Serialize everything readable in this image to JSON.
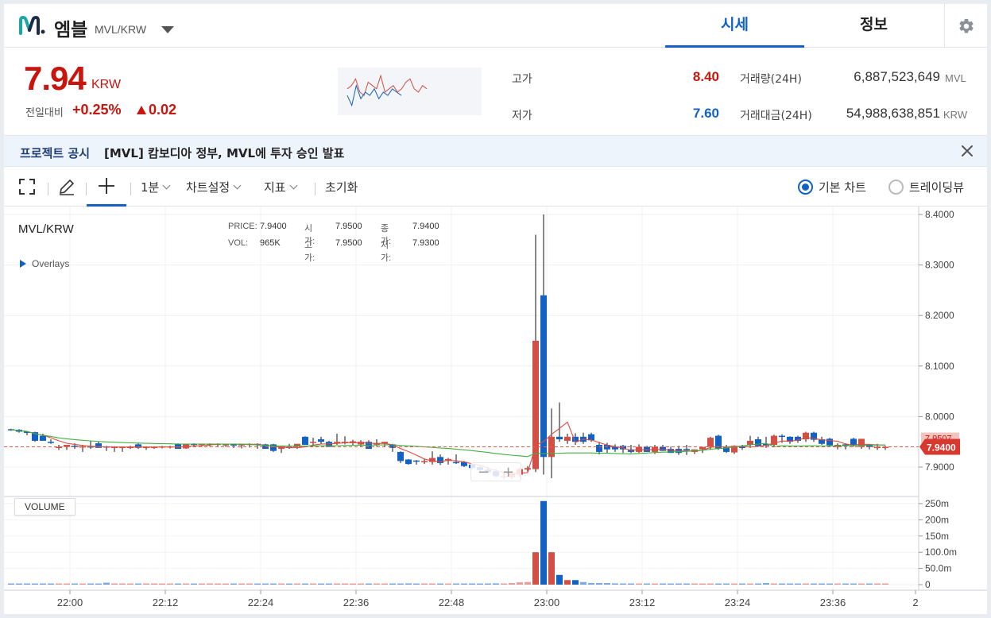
{
  "header": {
    "coin_name": "엠블",
    "pair": "MVL/KRW",
    "tabs": [
      {
        "label": "시세",
        "active": true
      },
      {
        "label": "정보",
        "active": false
      }
    ]
  },
  "summary": {
    "price": "7.94",
    "currency": "KRW",
    "change_label": "전일대비",
    "change_rate": "+0.25%",
    "change_amount": "0.02",
    "high_label": "고가",
    "high_value": "8.40",
    "low_label": "저가",
    "low_value": "7.60",
    "volume_label": "거래량(24H)",
    "volume_value": "6,887,523,649",
    "volume_unit": "MVL",
    "amount_label": "거래대금(24H)",
    "amount_value": "54,988,638,851",
    "amount_unit": "KRW"
  },
  "notice": {
    "tag": "프로젝트 공시",
    "text": "[MVL] 캄보디아 정부, MVL에 투자 승인 발표"
  },
  "toolbar": {
    "interval": "1분",
    "chart_settings": "차트설정",
    "indicators": "지표",
    "reset": "초기화",
    "basic_chart": "기본 차트",
    "tradingview": "트레이딩뷰"
  },
  "chart": {
    "symbol": "MVL/KRW",
    "overlays": "Overlays",
    "ohlc": {
      "price_label": "PRICE:",
      "price": "7.9400",
      "open_label": "시가:",
      "open": "7.9500",
      "close_label": "종가:",
      "close": "7.9400",
      "vol_label": "VOL:",
      "vol": "965K",
      "high_label": "고가:",
      "high": "7.9500",
      "low_label": "저가:",
      "low": "7.9300"
    },
    "volume_label": "VOLUME",
    "current_price_tag": "7.9400",
    "partial_tag": "7.9507",
    "zoom_minus": "−",
    "zoom_plus": "+"
  },
  "colors": {
    "up": "#d24f45",
    "down": "#1261c4",
    "ma_short": "#e04a3f",
    "ma_long": "#3fb13f",
    "accent": "#1261c4"
  },
  "chart_data": {
    "type": "candlestick",
    "symbol": "MVL/KRW",
    "price_axis": {
      "ticks": [
        "8.4000",
        "8.3000",
        "8.2000",
        "8.1000",
        "8.0000",
        "7.9000"
      ],
      "range": [
        7.86,
        8.4
      ]
    },
    "volume_axis": {
      "ticks": [
        "250m",
        "200m",
        "150m",
        "100.0m",
        "50.0m",
        "0"
      ],
      "range": [
        0,
        260
      ]
    },
    "time_ticks": [
      "22:00",
      "22:12",
      "22:24",
      "22:36",
      "22:48",
      "23:00",
      "23:12",
      "23:24",
      "23:36",
      "2"
    ],
    "start_minute": 1314,
    "candles": [
      {
        "o": 7.975,
        "h": 7.976,
        "l": 7.972,
        "c": 7.974,
        "v": 2
      },
      {
        "o": 7.974,
        "h": 7.975,
        "l": 7.968,
        "c": 7.97,
        "v": 2
      },
      {
        "o": 7.97,
        "h": 7.971,
        "l": 7.963,
        "c": 7.968,
        "v": 2
      },
      {
        "o": 7.969,
        "h": 7.97,
        "l": 7.95,
        "c": 7.952,
        "v": 2
      },
      {
        "o": 7.962,
        "h": 7.966,
        "l": 7.958,
        "c": 7.952,
        "v": 3
      },
      {
        "o": 7.95,
        "h": 7.955,
        "l": 7.946,
        "c": 7.948,
        "v": 2
      },
      {
        "o": 7.94,
        "h": 7.944,
        "l": 7.934,
        "c": 7.94,
        "v": 2
      },
      {
        "o": 7.94,
        "h": 7.942,
        "l": 7.934,
        "c": 7.944,
        "v": 3
      },
      {
        "o": 7.942,
        "h": 7.947,
        "l": 7.936,
        "c": 7.941,
        "v": 2
      },
      {
        "o": 7.941,
        "h": 7.944,
        "l": 7.93,
        "c": 7.941,
        "v": 2
      },
      {
        "o": 7.941,
        "h": 7.952,
        "l": 7.936,
        "c": 7.94,
        "v": 2
      },
      {
        "o": 7.947,
        "h": 7.951,
        "l": 7.943,
        "c": 7.938,
        "v": 3
      },
      {
        "o": 7.941,
        "h": 7.942,
        "l": 7.932,
        "c": 7.94,
        "v": 6
      },
      {
        "o": 7.94,
        "h": 7.941,
        "l": 7.93,
        "c": 7.94,
        "v": 2
      },
      {
        "o": 7.94,
        "h": 7.941,
        "l": 7.93,
        "c": 7.94,
        "v": 2
      },
      {
        "o": 7.94,
        "h": 7.942,
        "l": 7.936,
        "c": 7.94,
        "v": 2
      },
      {
        "o": 7.945,
        "h": 7.948,
        "l": 7.936,
        "c": 7.938,
        "v": 2
      },
      {
        "o": 7.94,
        "h": 7.941,
        "l": 7.934,
        "c": 7.94,
        "v": 2
      },
      {
        "o": 7.94,
        "h": 7.941,
        "l": 7.936,
        "c": 7.94,
        "v": 2
      },
      {
        "o": 7.94,
        "h": 7.942,
        "l": 7.937,
        "c": 7.941,
        "v": 2
      },
      {
        "o": 7.941,
        "h": 7.942,
        "l": 7.937,
        "c": 7.941,
        "v": 2
      },
      {
        "o": 7.946,
        "h": 7.947,
        "l": 7.937,
        "c": 7.936,
        "v": 2
      },
      {
        "o": 7.937,
        "h": 7.94,
        "l": 7.936,
        "c": 7.945,
        "v": 2
      },
      {
        "o": 7.946,
        "h": 7.947,
        "l": 7.94,
        "c": 7.945,
        "v": 2
      },
      {
        "o": 7.945,
        "h": 7.946,
        "l": 7.941,
        "c": 7.946,
        "v": 2
      },
      {
        "o": 7.946,
        "h": 7.947,
        "l": 7.941,
        "c": 7.946,
        "v": 2
      },
      {
        "o": 7.946,
        "h": 7.947,
        "l": 7.941,
        "c": 7.946,
        "v": 2
      },
      {
        "o": 7.945,
        "h": 7.946,
        "l": 7.94,
        "c": 7.945,
        "v": 2
      },
      {
        "o": 7.945,
        "h": 7.946,
        "l": 7.938,
        "c": 7.944,
        "v": 2
      },
      {
        "o": 7.944,
        "h": 7.946,
        "l": 7.937,
        "c": 7.945,
        "v": 2
      },
      {
        "o": 7.945,
        "h": 7.947,
        "l": 7.939,
        "c": 7.946,
        "v": 2
      },
      {
        "o": 7.946,
        "h": 7.947,
        "l": 7.936,
        "c": 7.945,
        "v": 2
      },
      {
        "o": 7.945,
        "h": 7.946,
        "l": 7.94,
        "c": 7.936,
        "v": 2
      },
      {
        "o": 7.945,
        "h": 7.946,
        "l": 7.93,
        "c": 7.932,
        "v": 2
      },
      {
        "o": 7.936,
        "h": 7.94,
        "l": 7.928,
        "c": 7.94,
        "v": 2
      },
      {
        "o": 7.94,
        "h": 7.946,
        "l": 7.936,
        "c": 7.938,
        "v": 2
      },
      {
        "o": 7.941,
        "h": 7.944,
        "l": 7.936,
        "c": 7.946,
        "v": 2
      },
      {
        "o": 7.96,
        "h": 7.961,
        "l": 7.945,
        "c": 7.944,
        "v": 2
      },
      {
        "o": 7.95,
        "h": 7.958,
        "l": 7.941,
        "c": 7.95,
        "v": 2
      },
      {
        "o": 7.955,
        "h": 7.96,
        "l": 7.945,
        "c": 7.95,
        "v": 3
      },
      {
        "o": 7.95,
        "h": 7.952,
        "l": 7.944,
        "c": 7.94,
        "v": 2
      },
      {
        "o": 7.95,
        "h": 7.966,
        "l": 7.944,
        "c": 7.95,
        "v": 2
      },
      {
        "o": 7.95,
        "h": 7.961,
        "l": 7.945,
        "c": 7.95,
        "v": 2
      },
      {
        "o": 7.95,
        "h": 7.954,
        "l": 7.943,
        "c": 7.951,
        "v": 2
      },
      {
        "o": 7.945,
        "h": 7.953,
        "l": 7.94,
        "c": 7.95,
        "v": 2
      },
      {
        "o": 7.95,
        "h": 7.953,
        "l": 7.938,
        "c": 7.936,
        "v": 2
      },
      {
        "o": 7.945,
        "h": 7.955,
        "l": 7.941,
        "c": 7.947,
        "v": 2
      },
      {
        "o": 7.947,
        "h": 7.95,
        "l": 7.94,
        "c": 7.95,
        "v": 2
      },
      {
        "o": 7.945,
        "h": 7.946,
        "l": 7.93,
        "c": 7.938,
        "v": 2
      },
      {
        "o": 7.93,
        "h": 7.931,
        "l": 7.908,
        "c": 7.912,
        "v": 3
      },
      {
        "o": 7.915,
        "h": 7.916,
        "l": 7.905,
        "c": 7.906,
        "v": 4
      },
      {
        "o": 7.913,
        "h": 7.914,
        "l": 7.905,
        "c": 7.912,
        "v": 3
      },
      {
        "o": 7.912,
        "h": 7.916,
        "l": 7.906,
        "c": 7.912,
        "v": 3
      },
      {
        "o": 7.91,
        "h": 7.931,
        "l": 7.905,
        "c": 7.918,
        "v": 2
      },
      {
        "o": 7.92,
        "h": 7.925,
        "l": 7.904,
        "c": 7.908,
        "v": 2
      },
      {
        "o": 7.915,
        "h": 7.918,
        "l": 7.905,
        "c": 7.916,
        "v": 2
      },
      {
        "o": 7.91,
        "h": 7.925,
        "l": 7.906,
        "c": 7.908,
        "v": 2
      },
      {
        "o": 7.91,
        "h": 7.912,
        "l": 7.9,
        "c": 7.902,
        "v": 2
      },
      {
        "o": 7.905,
        "h": 7.907,
        "l": 7.896,
        "c": 7.898,
        "v": 3
      },
      {
        "o": 7.9,
        "h": 7.902,
        "l": 7.892,
        "c": 7.894,
        "v": 3
      },
      {
        "o": 7.895,
        "h": 7.9,
        "l": 7.888,
        "c": 7.89,
        "v": 3
      },
      {
        "o": 7.892,
        "h": 7.896,
        "l": 7.88,
        "c": 7.882,
        "v": 4
      },
      {
        "o": 7.88,
        "h": 7.89,
        "l": 7.876,
        "c": 7.882,
        "v": 3
      },
      {
        "o": 7.88,
        "h": 7.89,
        "l": 7.876,
        "c": 7.888,
        "v": 5
      },
      {
        "o": 7.885,
        "h": 7.898,
        "l": 7.88,
        "c": 7.896,
        "v": 7
      },
      {
        "o": 7.895,
        "h": 7.902,
        "l": 7.89,
        "c": 7.898,
        "v": 8
      },
      {
        "o": 7.896,
        "h": 8.36,
        "l": 7.89,
        "c": 8.15,
        "v": 100
      },
      {
        "o": 8.24,
        "h": 8.4,
        "l": 7.885,
        "c": 7.92,
        "v": 258
      },
      {
        "o": 7.92,
        "h": 8.016,
        "l": 7.878,
        "c": 7.96,
        "v": 100
      },
      {
        "o": 7.96,
        "h": 8.028,
        "l": 7.95,
        "c": 7.955,
        "v": 30
      },
      {
        "o": 7.952,
        "h": 7.966,
        "l": 7.946,
        "c": 7.96,
        "v": 14
      },
      {
        "o": 7.96,
        "h": 7.967,
        "l": 7.944,
        "c": 7.95,
        "v": 14
      },
      {
        "o": 7.96,
        "h": 7.968,
        "l": 7.946,
        "c": 7.95,
        "v": 8
      },
      {
        "o": 7.965,
        "h": 7.968,
        "l": 7.95,
        "c": 7.953,
        "v": 5
      },
      {
        "o": 7.944,
        "h": 7.95,
        "l": 7.925,
        "c": 7.93,
        "v": 5
      },
      {
        "o": 7.944,
        "h": 7.948,
        "l": 7.928,
        "c": 7.935,
        "v": 5
      },
      {
        "o": 7.94,
        "h": 7.945,
        "l": 7.93,
        "c": 7.935,
        "v": 4
      },
      {
        "o": 7.942,
        "h": 7.944,
        "l": 7.928,
        "c": 7.935,
        "v": 3
      },
      {
        "o": 7.935,
        "h": 7.944,
        "l": 7.928,
        "c": 7.93,
        "v": 3
      },
      {
        "o": 7.93,
        "h": 7.945,
        "l": 7.928,
        "c": 7.94,
        "v": 3
      },
      {
        "o": 7.94,
        "h": 7.942,
        "l": 7.93,
        "c": 7.93,
        "v": 2
      },
      {
        "o": 7.93,
        "h": 7.944,
        "l": 7.926,
        "c": 7.94,
        "v": 2
      },
      {
        "o": 7.94,
        "h": 7.944,
        "l": 7.932,
        "c": 7.932,
        "v": 2
      },
      {
        "o": 7.936,
        "h": 7.94,
        "l": 7.928,
        "c": 7.928,
        "v": 2
      },
      {
        "o": 7.936,
        "h": 7.942,
        "l": 7.924,
        "c": 7.928,
        "v": 2
      },
      {
        "o": 7.936,
        "h": 7.944,
        "l": 7.924,
        "c": 7.934,
        "v": 2
      },
      {
        "o": 7.93,
        "h": 7.935,
        "l": 7.926,
        "c": 7.935,
        "v": 2
      },
      {
        "o": 7.935,
        "h": 7.938,
        "l": 7.928,
        "c": 7.94,
        "v": 2
      },
      {
        "o": 7.94,
        "h": 7.96,
        "l": 7.934,
        "c": 7.958,
        "v": 3
      },
      {
        "o": 7.962,
        "h": 7.964,
        "l": 7.934,
        "c": 7.936,
        "v": 3
      },
      {
        "o": 7.94,
        "h": 7.944,
        "l": 7.928,
        "c": 7.93,
        "v": 3
      },
      {
        "o": 7.929,
        "h": 7.943,
        "l": 7.926,
        "c": 7.942,
        "v": 3
      },
      {
        "o": 7.94,
        "h": 7.944,
        "l": 7.934,
        "c": 7.939,
        "v": 3
      },
      {
        "o": 7.944,
        "h": 7.962,
        "l": 7.938,
        "c": 7.952,
        "v": 3
      },
      {
        "o": 7.955,
        "h": 7.96,
        "l": 7.94,
        "c": 7.942,
        "v": 2
      },
      {
        "o": 7.946,
        "h": 7.96,
        "l": 7.938,
        "c": 7.942,
        "v": 5
      },
      {
        "o": 7.944,
        "h": 7.964,
        "l": 7.94,
        "c": 7.962,
        "v": 2
      },
      {
        "o": 7.962,
        "h": 7.965,
        "l": 7.948,
        "c": 7.96,
        "v": 2
      },
      {
        "o": 7.96,
        "h": 7.961,
        "l": 7.946,
        "c": 7.95,
        "v": 2
      },
      {
        "o": 7.96,
        "h": 7.962,
        "l": 7.948,
        "c": 7.952,
        "v": 3
      },
      {
        "o": 7.955,
        "h": 7.97,
        "l": 7.95,
        "c": 7.968,
        "v": 2
      },
      {
        "o": 7.968,
        "h": 7.97,
        "l": 7.95,
        "c": 7.954,
        "v": 2
      },
      {
        "o": 7.955,
        "h": 7.96,
        "l": 7.944,
        "c": 7.946,
        "v": 2
      },
      {
        "o": 7.956,
        "h": 7.958,
        "l": 7.942,
        "c": 7.943,
        "v": 2
      },
      {
        "o": 7.94,
        "h": 7.947,
        "l": 7.935,
        "c": 7.944,
        "v": 2
      },
      {
        "o": 7.945,
        "h": 7.947,
        "l": 7.935,
        "c": 7.942,
        "v": 3
      },
      {
        "o": 7.956,
        "h": 7.958,
        "l": 7.94,
        "c": 7.942,
        "v": 2
      },
      {
        "o": 7.94,
        "h": 7.956,
        "l": 7.936,
        "c": 7.956,
        "v": 2
      },
      {
        "o": 7.944,
        "h": 7.946,
        "l": 7.935,
        "c": 7.94,
        "v": 2
      },
      {
        "o": 7.94,
        "h": 7.946,
        "l": 7.934,
        "c": 7.94,
        "v": 2
      },
      {
        "o": 7.94,
        "h": 7.942,
        "l": 7.934,
        "c": 7.94,
        "v": 1
      }
    ]
  },
  "sparkline": {
    "red": [
      7.95,
      7.96,
      7.98,
      7.94,
      7.93,
      7.97,
      7.96,
      7.95,
      7.99,
      7.94,
      7.95,
      7.96,
      7.94,
      7.95,
      7.97,
      7.98,
      7.95,
      7.94,
      7.96,
      7.95
    ],
    "blue": [
      7.93,
      7.9,
      7.96,
      7.92,
      7.94,
      7.93,
      7.95,
      7.92,
      7.94,
      7.93,
      7.95,
      7.94,
      7.93
    ]
  }
}
